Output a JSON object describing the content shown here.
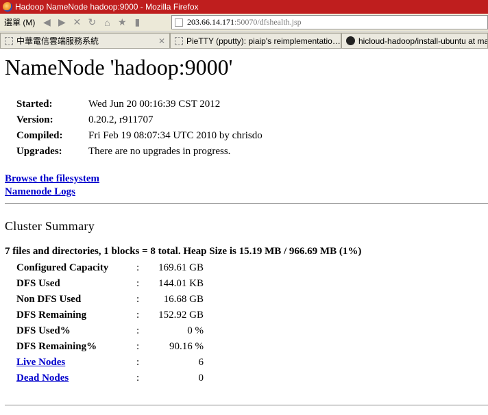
{
  "window": {
    "title": "Hadoop NameNode hadoop:9000 - Mozilla Firefox"
  },
  "toolbar": {
    "menu_label": "選單 (M)",
    "url_host": "203.66.14.171",
    "url_path": ":50070/dfshealth.jsp"
  },
  "tabs": [
    {
      "label": "中華電信雲端服務系統",
      "icon": "page-icon"
    },
    {
      "label": "PieTTY (pputty): piaip's reimplementatio…",
      "icon": "page-icon"
    },
    {
      "label": "hicloud-hadoop/install-ubuntu at master",
      "icon": "github-icon"
    }
  ],
  "page": {
    "heading": "NameNode 'hadoop:9000'",
    "info": [
      {
        "label": "Started:",
        "value": "Wed Jun 20 00:16:39 CST 2012"
      },
      {
        "label": "Version:",
        "value": "0.20.2, r911707"
      },
      {
        "label": "Compiled:",
        "value": "Fri Feb 19 08:07:34 UTC 2010 by chrisdo"
      },
      {
        "label": "Upgrades:",
        "value": "There are no upgrades in progress."
      }
    ],
    "links": {
      "browse": "Browse the filesystem",
      "logs": "Namenode Logs"
    },
    "cluster_title": "Cluster Summary",
    "summary_line": "7 files and directories, 1 blocks = 8 total. Heap Size is 15.19 MB / 966.69 MB (1%)",
    "colon": ":",
    "stats": [
      {
        "label": "Configured Capacity",
        "value": "169.61 GB",
        "link": false
      },
      {
        "label": "DFS Used",
        "value": "144.01 KB",
        "link": false
      },
      {
        "label": "Non DFS Used",
        "value": "16.68 GB",
        "link": false
      },
      {
        "label": "DFS Remaining",
        "value": "152.92 GB",
        "link": false
      },
      {
        "label": "DFS Used%",
        "value": "0 %",
        "link": false
      },
      {
        "label": "DFS Remaining%",
        "value": "90.16 %",
        "link": false
      },
      {
        "label": "Live Nodes",
        "value": "6",
        "link": true
      },
      {
        "label": "Dead Nodes",
        "value": "0",
        "link": true
      }
    ]
  }
}
